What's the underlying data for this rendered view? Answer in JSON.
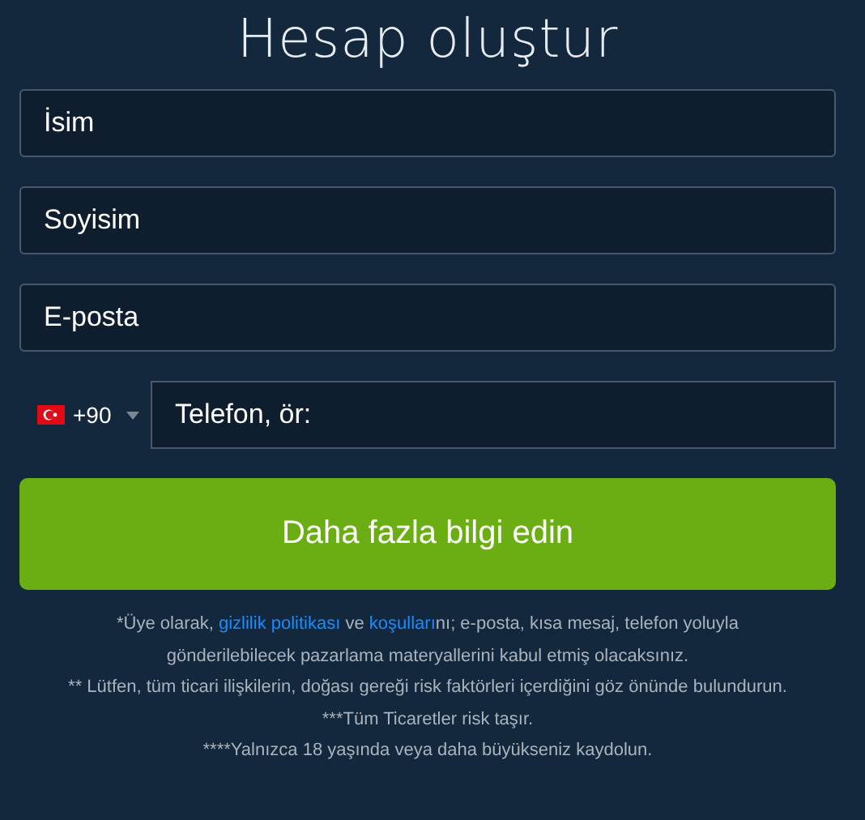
{
  "title": "Hesap oluştur",
  "fields": [
    {
      "placeholder": "İsim"
    },
    {
      "placeholder": "Soyisim"
    },
    {
      "placeholder": "E-posta"
    }
  ],
  "phone": {
    "code": "+90",
    "placeholder": "Telefon, ör:"
  },
  "submit": "Daha fazla bilgi edin",
  "notes": [
    {
      "parts": [
        {
          "kind": "text",
          "text": "*Üye olarak, "
        },
        {
          "kind": "link",
          "text": "gizlilik politikası"
        },
        {
          "kind": "text",
          "text": " ve "
        },
        {
          "kind": "link",
          "text": "koşulları"
        },
        {
          "kind": "text",
          "text": "nı; e-posta, kısa mesaj, telefon yoluyla gönderilebilecek pazarlama materyallerini kabul etmiş olacaksınız."
        }
      ]
    },
    {
      "parts": [
        {
          "kind": "text",
          "text": "** Lütfen, tüm ticari ilişkilerin, doğası gereği risk faktörleri içerdiğini göz önünde bulundurun."
        }
      ]
    },
    {
      "parts": [
        {
          "kind": "text",
          "text": "***Tüm Ticaretler risk taşır."
        }
      ]
    },
    {
      "parts": [
        {
          "kind": "text",
          "text": "****Yalnızca 18 yaşında veya daha büyükseniz kaydolun."
        }
      ]
    }
  ]
}
